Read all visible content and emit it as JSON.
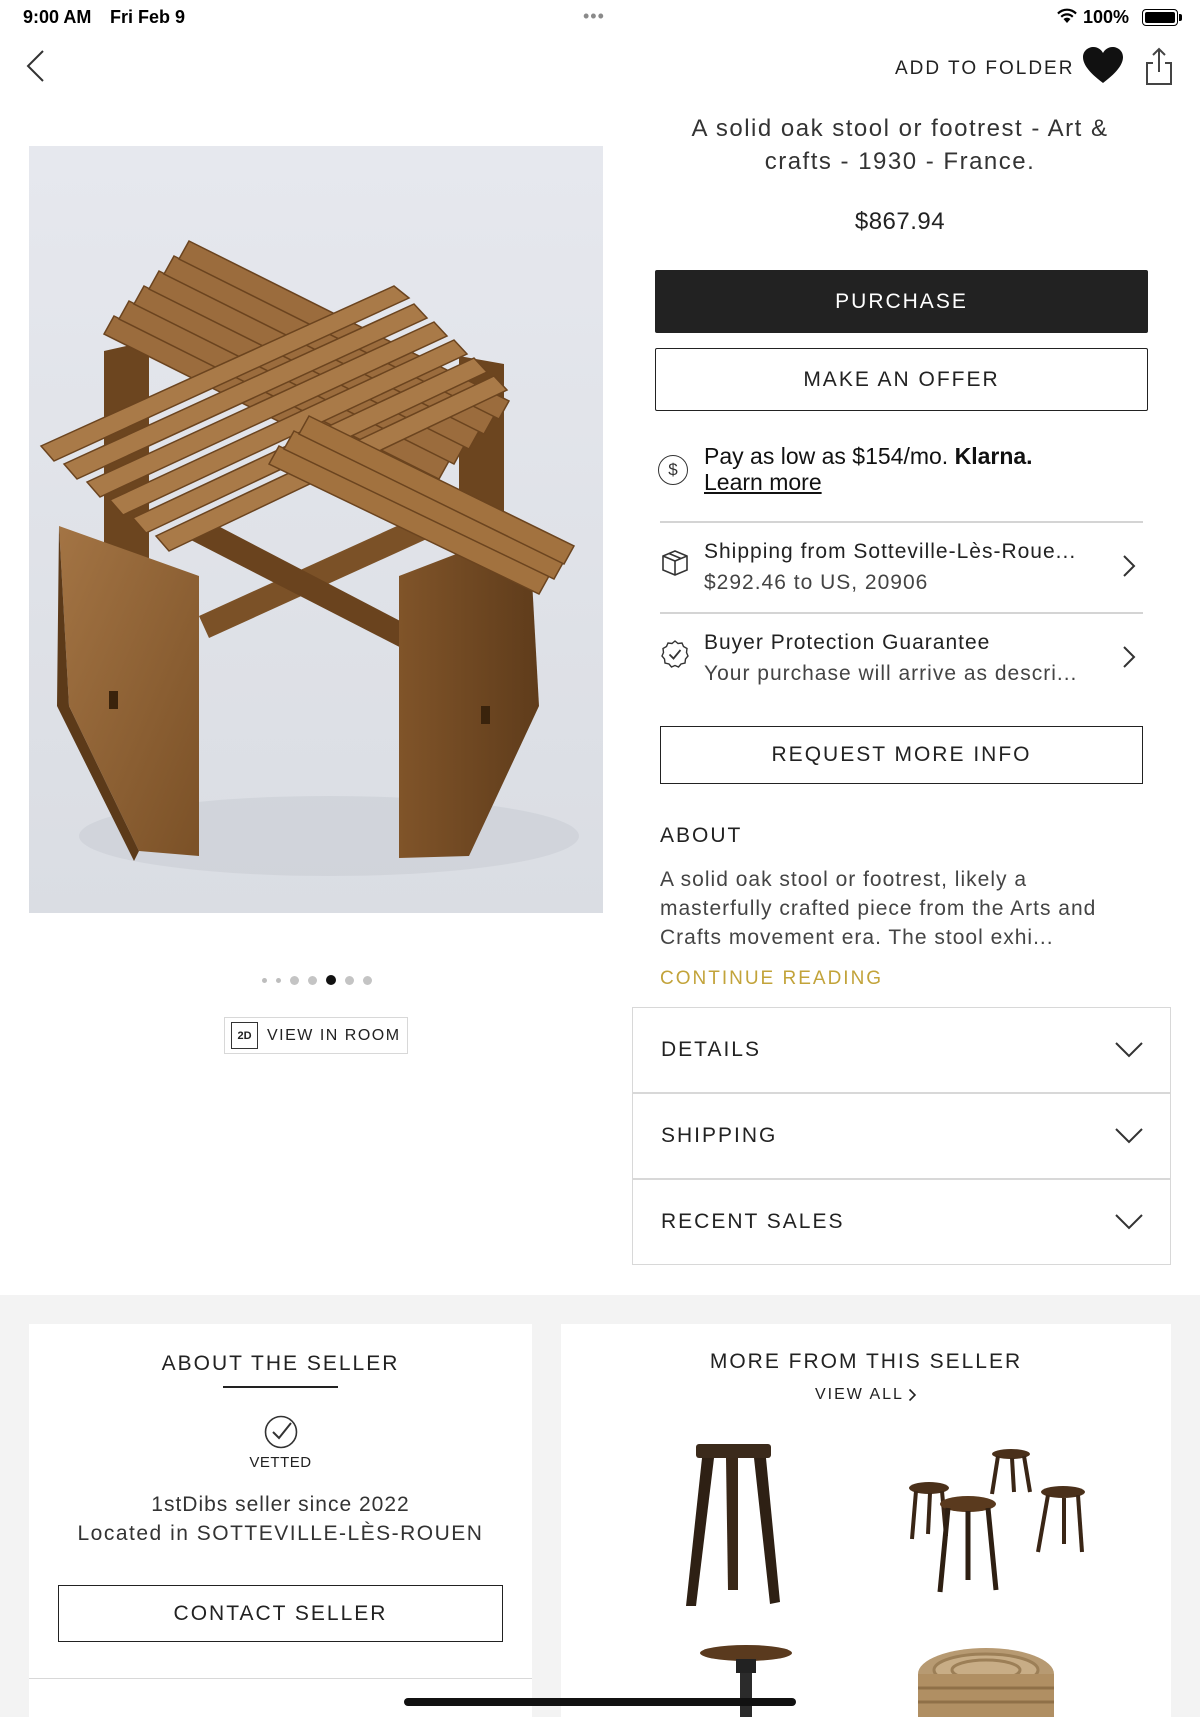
{
  "status_bar": {
    "time": "9:00 AM",
    "date": "Fri Feb 9",
    "multitask": "•••",
    "battery_text": "100%",
    "battery_level": 1.0
  },
  "nav": {
    "back_icon": "chevron-left-icon",
    "add_to_folder": "ADD TO FOLDER",
    "favorite_icon": "heart-icon",
    "share_icon": "share-icon"
  },
  "gallery": {
    "page_count": 7,
    "active_index": 4,
    "view_in_room_badge": "2D",
    "view_in_room_label": "VIEW IN ROOM"
  },
  "product": {
    "title": "A solid oak stool or footrest - Art & crafts - 1930 - France.",
    "price": "$867.94",
    "purchase_label": "PURCHASE",
    "offer_label": "MAKE AN OFFER"
  },
  "klarna": {
    "icon_glyph": "$",
    "text": "Pay as low as $154/mo.",
    "brand": "Klarna.",
    "learn_more": "Learn more"
  },
  "shipping": {
    "icon": "box-icon",
    "line1": "Shipping from Sotteville-Lès-Roue...",
    "line2": "$292.46 to US, 20906"
  },
  "protection": {
    "icon": "check-circle-icon",
    "line1": "Buyer Protection Guarantee",
    "line2": "Your purchase will arrive as descri..."
  },
  "request_info_label": "REQUEST MORE INFO",
  "about": {
    "heading": "ABOUT",
    "body": "A solid oak stool or footrest, likely a masterfully crafted piece from the Arts and Crafts movement era. The stool exhi...",
    "continue_label": "CONTINUE READING",
    "continue_color": "#c2a33a"
  },
  "accordions": [
    {
      "label": "DETAILS"
    },
    {
      "label": "SHIPPING"
    },
    {
      "label": "RECENT SALES"
    }
  ],
  "seller": {
    "heading": "ABOUT THE SELLER",
    "vetted_label": "VETTED",
    "since": "1stDibs seller since 2022",
    "location": "Located in SOTTEVILLE-LÈS-ROUEN",
    "contact_label": "CONTACT SELLER"
  },
  "more_from_seller": {
    "heading": "MORE FROM THIS SELLER",
    "view_all": "VIEW ALL"
  },
  "colors": {
    "primary_button": "#222222",
    "page_bg": "#ffffff",
    "bottom_bg": "#f3f3f3",
    "accent_gold": "#c2a33a"
  }
}
